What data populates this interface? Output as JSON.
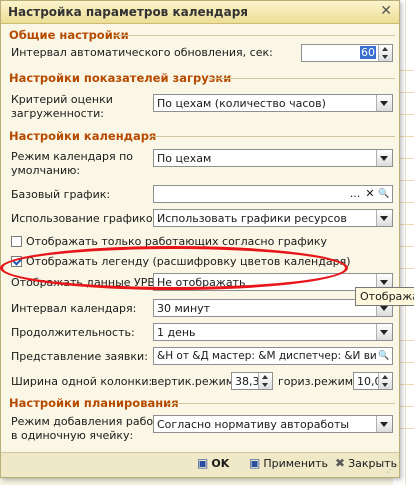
{
  "window": {
    "title": "Настройка параметров календаря",
    "close_glyph": "✕"
  },
  "general": {
    "section_title": "Общие настройки",
    "refresh_label": "Интервал автоматического обновления, сек:",
    "refresh_value": "60"
  },
  "load": {
    "section_title": "Настройки показателей загрузки",
    "criterion_label_1": "Критерий оценки",
    "criterion_label_2": "загруженности:",
    "criterion_value": "По цехам (количество часов)"
  },
  "calendar": {
    "section_title": "Настройки календаря",
    "mode_label_1": "Режим календаря по",
    "mode_label_2": "умолчанию:",
    "mode_value": "По цехам",
    "base_label": "Базовый график:",
    "base_value": "",
    "base_buttons": {
      "select": "...",
      "clear": "✕",
      "search": "🔍"
    },
    "usage_label": "Использование графиков:",
    "usage_value": "Использовать графики ресурсов",
    "only_working_label": "Отображать только работающих согласно графику",
    "only_working_checked": false,
    "legend_label": "Отображать легенду (расшифровку цветов календаря)",
    "legend_checked": true,
    "urv_label": "Отображать данные УРВ:",
    "urv_value": "Не отображать",
    "tooltip_text": "Отображать",
    "interval_label": "Интервал календаря:",
    "interval_value": "30 минут",
    "duration_label": "Продолжительность:",
    "duration_value": "1 день",
    "request_view_label": "Представление заявки:",
    "request_view_value": "&Н от &Д мастер: &М диспетчер: &И вид рем",
    "column_width_label": "Ширина одной колонки:",
    "vert_label": "вертик.режим:",
    "vert_value": "38,3",
    "horiz_label": "гориз.режим:",
    "horiz_value": "10,0"
  },
  "planning": {
    "section_title": "Настройки планирования",
    "add_mode_label_1": "Режим добавления работ",
    "add_mode_label_2": "в одиночную ячейку:",
    "add_mode_value": "Согласно нормативу автоработы"
  },
  "footer": {
    "ok_label": "OK",
    "apply_label": "Применить",
    "close_label": "Закрыть"
  },
  "colors": {
    "section": "#b54a00",
    "highlight": "#e8161b",
    "tooltip_bg": "#fff8dc"
  }
}
